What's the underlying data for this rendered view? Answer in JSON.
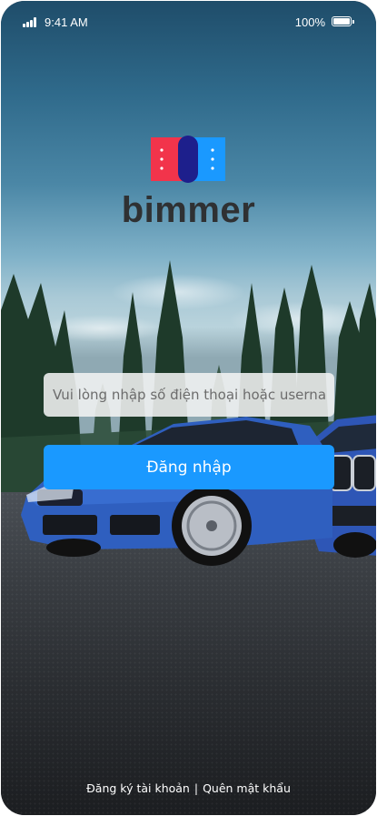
{
  "status_bar": {
    "time": "9:41 AM",
    "battery": "100%",
    "icons": [
      "signal-icon",
      "battery-icon"
    ]
  },
  "app": {
    "brand": "bimmer",
    "logo": "bimmer-logo-icon",
    "colors": {
      "logo_red": "#f2344b",
      "logo_navy": "#1d1f8c",
      "logo_blue": "#1a99ff",
      "button": "#1a99ff"
    }
  },
  "login": {
    "username_value": "",
    "username_placeholder": "Vui lòng nhập số điện thoại hoặc username",
    "submit_label": "Đăng nhập"
  },
  "footer": {
    "register": "Đăng ký tài khoản",
    "separator": "|",
    "forgot": "Quên mật khẩu"
  }
}
